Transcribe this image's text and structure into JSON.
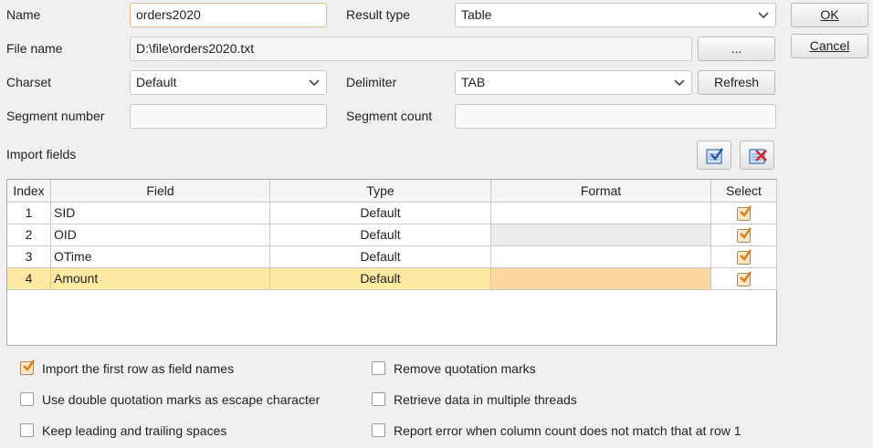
{
  "form": {
    "name_label": "Name",
    "name_value": "orders2020",
    "result_type_label": "Result type",
    "result_type_value": "Table",
    "file_name_label": "File name",
    "file_name_value": "D:\\file\\orders2020.txt",
    "browse_label": "...",
    "charset_label": "Charset",
    "charset_value": "Default",
    "delimiter_label": "Delimiter",
    "delimiter_value": "TAB",
    "refresh_label": "Refresh",
    "segment_number_label": "Segment number",
    "segment_number_value": "",
    "segment_count_label": "Segment count",
    "segment_count_value": "",
    "import_fields_label": "Import fields",
    "select_all_icon": "select-all-icon",
    "deselect_all_icon": "deselect-all-icon"
  },
  "actions": {
    "ok_label": "OK",
    "cancel_label": "Cancel"
  },
  "table": {
    "headers": [
      "Index",
      "Field",
      "Type",
      "Format",
      "Select"
    ],
    "rows": [
      {
        "index": "1",
        "field": "SID",
        "type": "Default",
        "format": "",
        "selected": true
      },
      {
        "index": "2",
        "field": "OID",
        "type": "Default",
        "format": "",
        "selected": true
      },
      {
        "index": "3",
        "field": "OTime",
        "type": "Default",
        "format": "",
        "selected": true
      },
      {
        "index": "4",
        "field": "Amount",
        "type": "Default",
        "format": "",
        "selected": true
      }
    ]
  },
  "options": {
    "first_row_names": {
      "label": "Import the first row as field names",
      "checked": true
    },
    "double_quote_escape": {
      "label": "Use double quotation marks as escape character",
      "checked": false
    },
    "keep_spaces": {
      "label": "Keep leading and trailing spaces",
      "checked": false
    },
    "remove_quotes": {
      "label": "Remove quotation marks",
      "checked": false
    },
    "multi_threads": {
      "label": "Retrieve data in multiple threads",
      "checked": false
    },
    "report_error": {
      "label": "Report error when column count does not match that at row 1",
      "checked": false
    }
  },
  "colors": {
    "selected_row": "#fde9a4",
    "selected_format": "#fbd7a2",
    "checkbox_fill": "#fbe7c8",
    "check_mark": "#e07b17"
  }
}
